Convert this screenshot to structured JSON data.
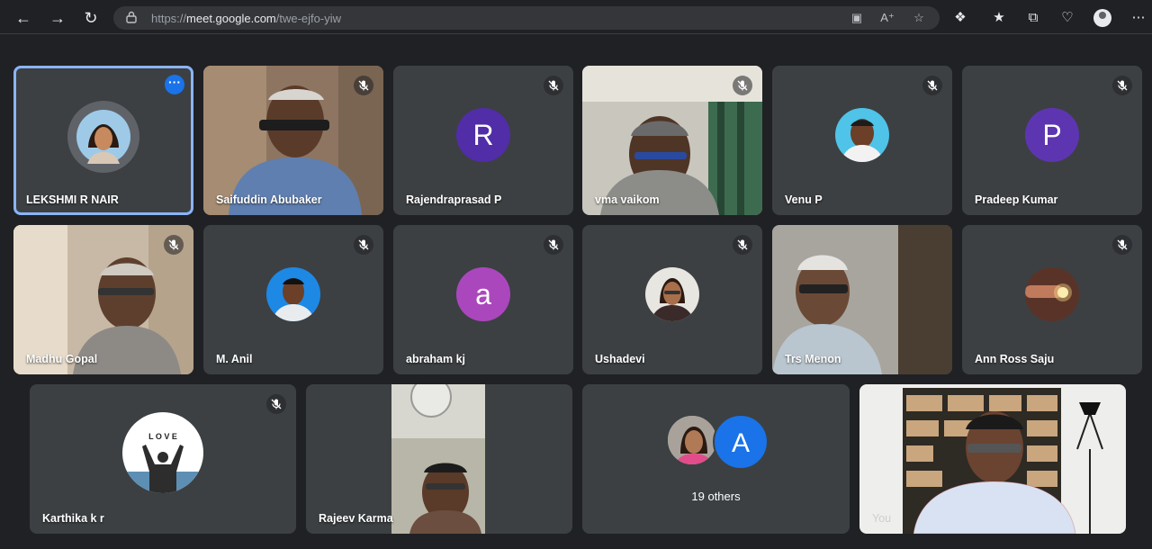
{
  "browser": {
    "url_prefix": "https://",
    "url_host": "meet.google.com",
    "url_path": "/twe-ejfo-yiw"
  },
  "participants": [
    {
      "name": "LEKSHMI R NAIR",
      "kind": "photo-avatar",
      "active": true
    },
    {
      "name": "Saifuddin Abubaker",
      "kind": "video",
      "muted": true
    },
    {
      "name": "Rajendraprasad P",
      "kind": "letter",
      "letter": "R",
      "color": "#512da8",
      "muted": true
    },
    {
      "name": "vma vaikom",
      "kind": "video",
      "muted": true
    },
    {
      "name": "Venu P",
      "kind": "photo-avatar",
      "muted": true
    },
    {
      "name": "Pradeep Kumar",
      "kind": "letter",
      "letter": "P",
      "color": "#5e35b1",
      "muted": true
    },
    {
      "name": "Madhu Gopal",
      "kind": "video",
      "muted": true
    },
    {
      "name": "M. Anil",
      "kind": "photo-avatar",
      "muted": true
    },
    {
      "name": "abraham kj",
      "kind": "letter",
      "letter": "a",
      "color": "#ab47bc",
      "muted": true
    },
    {
      "name": "Ushadevi",
      "kind": "photo-avatar",
      "muted": true
    },
    {
      "name": "Trs Menon",
      "kind": "video",
      "muted": false
    },
    {
      "name": "Ann Ross Saju",
      "kind": "photo-avatar",
      "muted": true
    },
    {
      "name": "Karthika k r",
      "kind": "photo-avatar",
      "muted": true
    },
    {
      "name": "Rajeev Karma",
      "kind": "video",
      "muted": false
    },
    {
      "name": "19 others",
      "kind": "others",
      "letter": "A",
      "color": "#1a73e8"
    },
    {
      "name": "You",
      "kind": "video",
      "muted": false
    }
  ],
  "karthika_avatar_text": "L O V E"
}
